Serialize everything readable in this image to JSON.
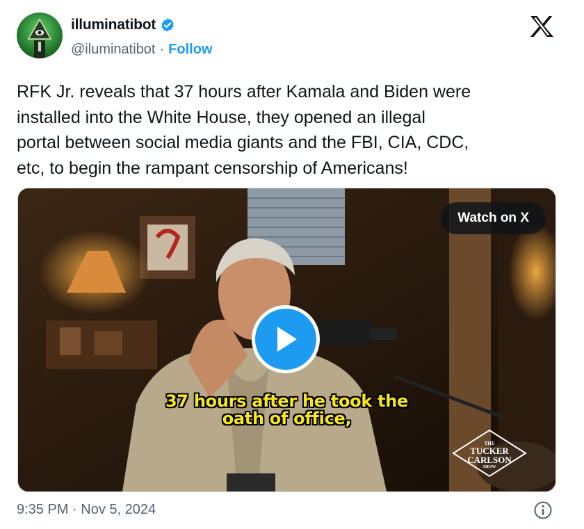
{
  "author": {
    "name": "illuminatibot",
    "handle": "@iluminatibot",
    "separator": "·",
    "follow_label": "Follow",
    "verified": true
  },
  "colors": {
    "accent": "#1d9bf0",
    "text": "#0f1419",
    "muted": "#536471",
    "caption": "#f5e61e"
  },
  "icons": {
    "brand": "x-logo",
    "verified": "verified-badge-icon",
    "play": "play-icon",
    "info": "info-icon"
  },
  "tweet": {
    "text": "RFK Jr. reveals that 37 hours after Kamala and Biden were\ninstalled into the White House, they opened an illegal\nportal between social media giants and the FBI, CIA, CDC,\netc, to begin the rampant censorship of Americans!"
  },
  "media": {
    "watch_label": "Watch on X",
    "caption_lines": [
      "37 hours after he took the",
      "oath of office,"
    ],
    "show_logo": {
      "the": "THE",
      "line1": "TUCKER",
      "line2": "CARLSON",
      "show": "SHOW"
    }
  },
  "footer": {
    "timestamp": "9:35 PM · Nov 5, 2024"
  }
}
